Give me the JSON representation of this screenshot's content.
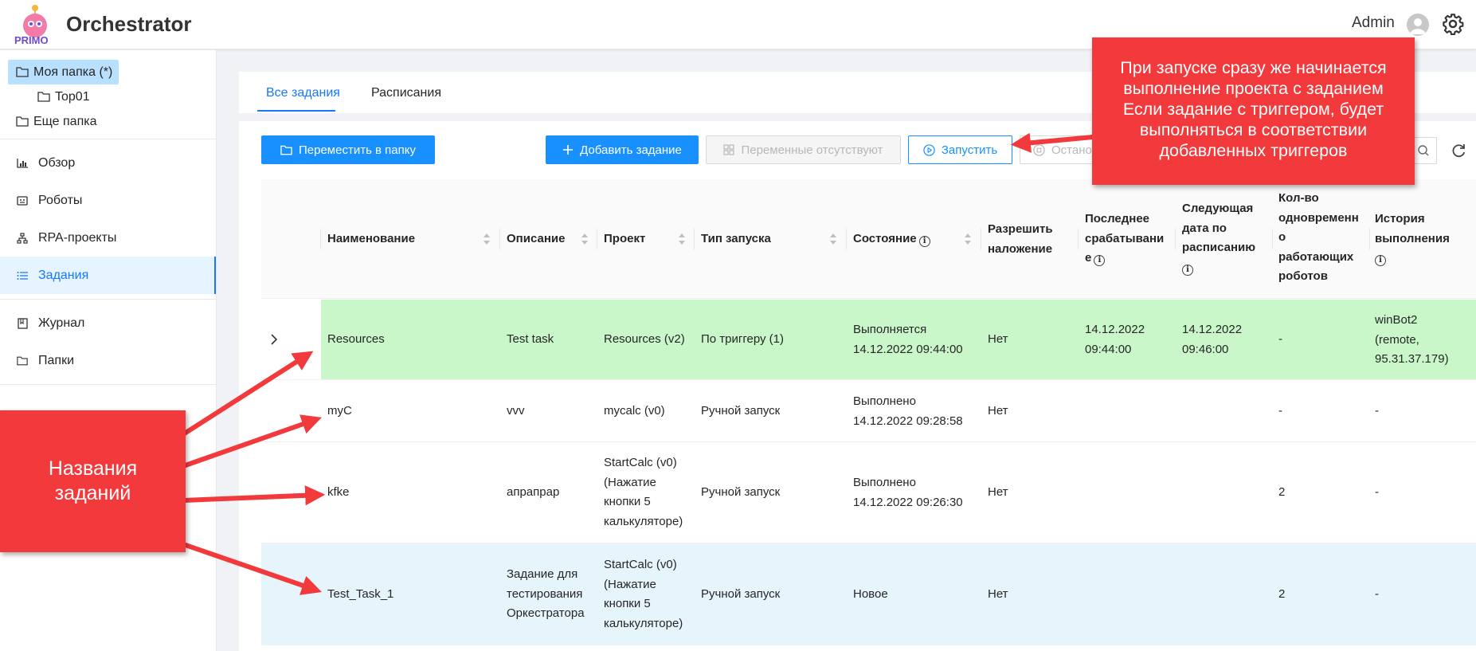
{
  "app": {
    "title": "Orchestrator",
    "user": "Admin",
    "logo_text": "PRIMO"
  },
  "sidebar": {
    "folders": [
      {
        "label": "Моя папка (*)"
      },
      {
        "label": "Top01"
      },
      {
        "label": "Еще папка"
      }
    ],
    "menu": [
      {
        "label": "Обзор",
        "icon": "bar-chart-icon"
      },
      {
        "label": "Роботы",
        "icon": "robot-icon"
      },
      {
        "label": "RPA-проекты",
        "icon": "cluster-icon"
      },
      {
        "label": "Задания",
        "icon": "list-icon"
      },
      {
        "label": "Журнал",
        "icon": "book-icon"
      },
      {
        "label": "Папки",
        "icon": "folder-icon"
      }
    ]
  },
  "tabs": [
    {
      "label": "Все задания"
    },
    {
      "label": "Расписания"
    }
  ],
  "toolbar": {
    "move": "Переместить в папку",
    "add": "Добавить задание",
    "variables": "Переменные отсутствуют",
    "run": "Запустить",
    "stop": "Останов"
  },
  "table": {
    "headers": [
      "Наименование",
      "Описание",
      "Проект",
      "Тип запуска",
      "Состояние",
      "Разрешить наложение",
      "Последнее срабатывание",
      "Следующая дата по расписанию",
      "Кол-во одновременно работающих роботов",
      "История выполнения"
    ],
    "header_lines": {
      "overlap": [
        "Разрешить",
        "наложение"
      ],
      "last": [
        "Последнее",
        "срабатывани",
        "е"
      ],
      "next": [
        "Следующая",
        "дата по",
        "расписанию"
      ],
      "count": [
        "Кол-во",
        "одновременн",
        "о",
        "работающих",
        "роботов"
      ],
      "history": [
        "История",
        "выполнения"
      ]
    },
    "rows": [
      {
        "name": "Resources",
        "description": "Test task",
        "project": "Resources (v2)",
        "launch": "По триггеру (1)",
        "state": [
          "Выполняется",
          "14.12.2022 09:44:00"
        ],
        "overlap": "Нет",
        "last": [
          "14.12.2022",
          "09:44:00"
        ],
        "next": [
          "14.12.2022",
          "09:46:00"
        ],
        "count": "-",
        "history": [
          "winBot2",
          "(remote,",
          "95.31.37.179)"
        ]
      },
      {
        "name": "myC",
        "description": "vvv",
        "project": "mycalc (v0)",
        "launch": "Ручной запуск",
        "state": [
          "Выполнено",
          "14.12.2022 09:28:58"
        ],
        "overlap": "Нет",
        "last": [],
        "next": [],
        "count": "-",
        "history": [
          "-"
        ]
      },
      {
        "name": "kfke",
        "description": "апрапрар",
        "project": [
          "StartCalc (v0)",
          "(Нажатие",
          "кнопки 5",
          "калькуляторе)"
        ],
        "launch": "Ручной запуск",
        "state": [
          "Выполнено",
          "14.12.2022 09:26:30"
        ],
        "overlap": "Нет",
        "last": [],
        "next": [],
        "count": "2",
        "history": [
          "-"
        ]
      },
      {
        "name": "Test_Task_1",
        "description": [
          "Задание для",
          "тестирования",
          "Оркестратора"
        ],
        "project": [
          "StartCalc (v0)",
          "(Нажатие",
          "кнопки 5",
          "калькуляторе)"
        ],
        "launch": "Ручной запуск",
        "state": [
          "Новое"
        ],
        "overlap": "Нет",
        "last": [],
        "next": [],
        "count": "2",
        "history": [
          "-"
        ]
      }
    ]
  },
  "annotations": {
    "top_callout": [
      "При запуске сразу же начинается",
      "выполнение проекта с заданием",
      "Если задание с триггером, будет",
      "выполняться в соответствии",
      "добавленных триггеров"
    ],
    "left_callout": [
      "Названия",
      "заданий"
    ]
  },
  "colors": {
    "accent": "#1890ff",
    "running_row": "#c9f7c9",
    "selected_row": "#e6f4fc",
    "callout": "#f2393b"
  }
}
